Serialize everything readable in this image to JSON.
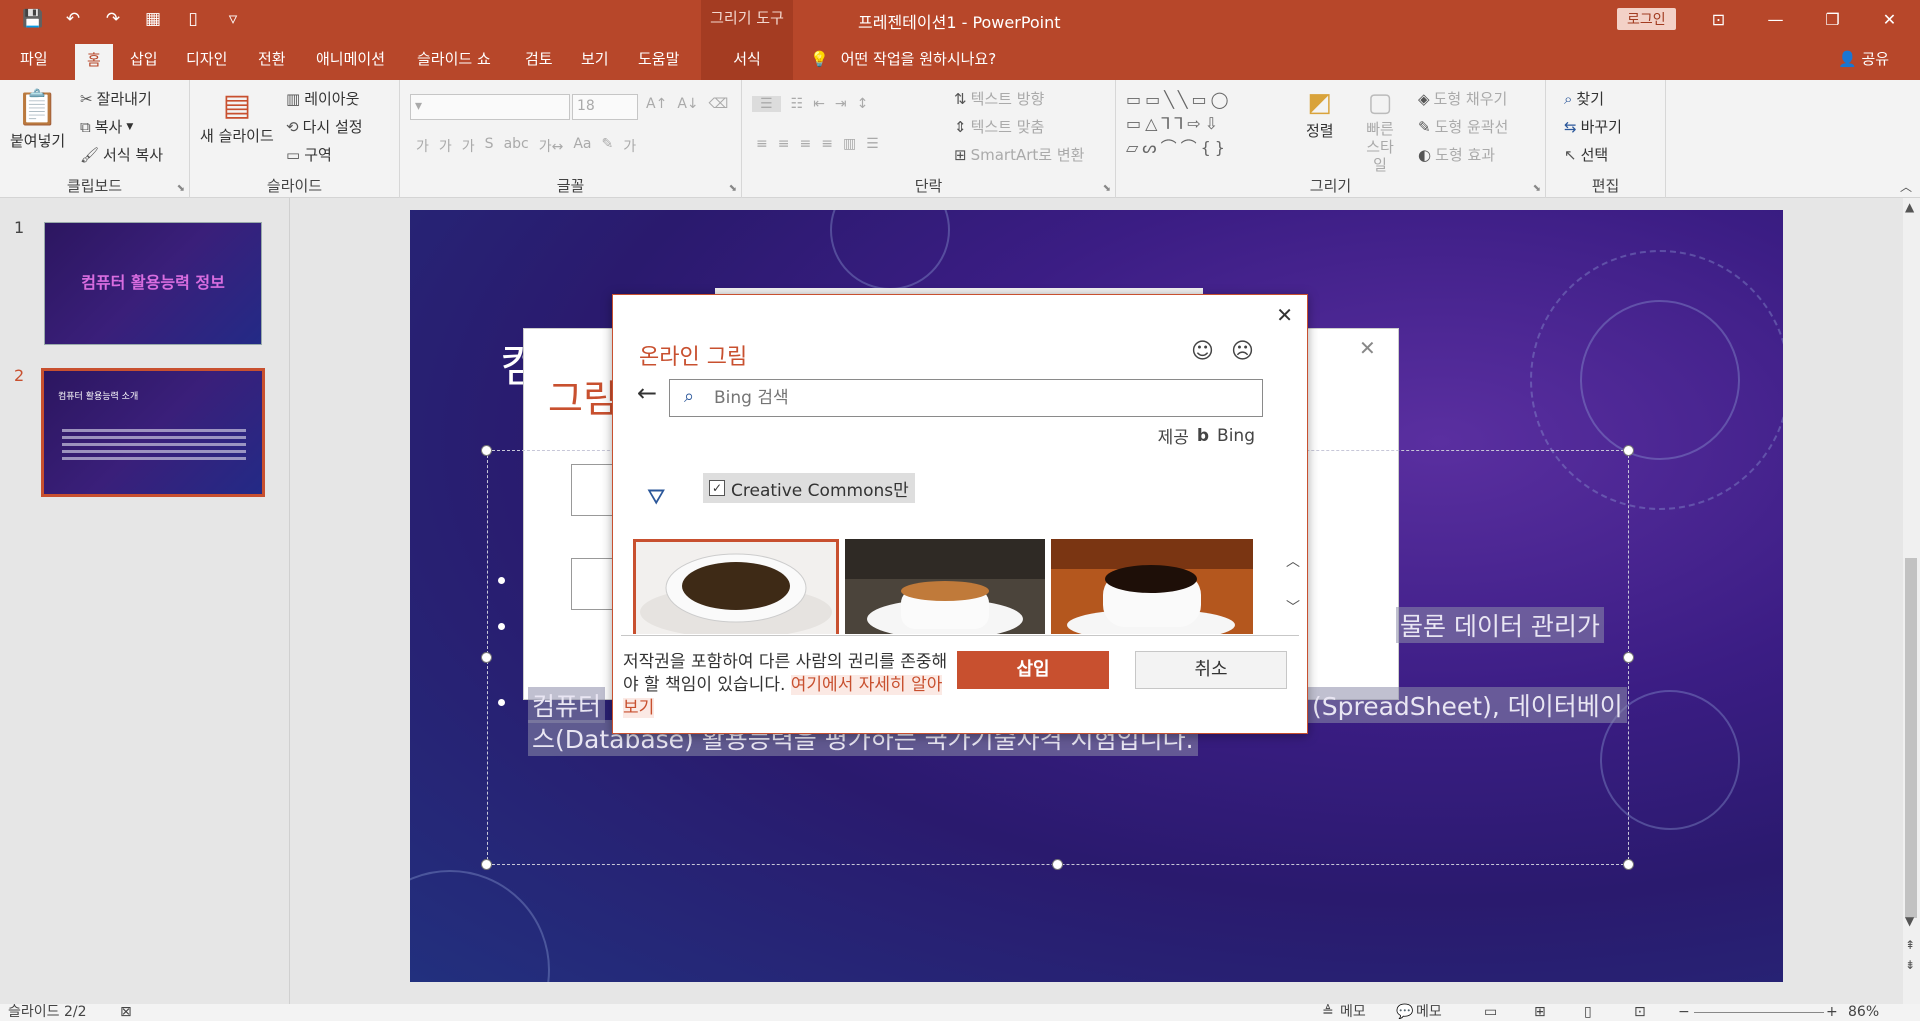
{
  "titlebar": {
    "context_tab": "그리기 도구",
    "title": "프레젠테이션1  -  PowerPoint",
    "login": "로그인",
    "qat_icons": [
      "save-icon",
      "undo-icon",
      "redo-icon",
      "presenter-icon",
      "new-doc-icon",
      "customize-icon"
    ]
  },
  "tabs": [
    "파일",
    "홈",
    "삽입",
    "디자인",
    "전환",
    "애니메이션",
    "슬라이드 쇼",
    "검토",
    "보기",
    "도움말"
  ],
  "context_tab_label": "서식",
  "tellme": "어떤 작업을 원하시나요?",
  "share": "공유",
  "ribbon": {
    "clipboard": {
      "paste": "붙여넣기",
      "cut": "잘라내기",
      "copy": "복사",
      "format_painter": "서식 복사",
      "label": "클립보드"
    },
    "slides": {
      "new_slide": "새 슬라이드",
      "layout": "레이아웃",
      "reset": "다시 설정",
      "section": "구역",
      "label": "슬라이드"
    },
    "font": {
      "size": "18",
      "label": "글꼴"
    },
    "paragraph": {
      "text_direction": "텍스트 방향",
      "align_text": "텍스트 맞춤",
      "smartart": "SmartArt로 변환",
      "label": "단락"
    },
    "drawing": {
      "arrange": "정렬",
      "quick_styles": "빠른 스타일",
      "fill": "도형 채우기",
      "outline": "도형 윤곽선",
      "effects": "도형 효과",
      "label": "그리기"
    },
    "editing": {
      "find": "찾기",
      "replace": "바꾸기",
      "select": "선택",
      "label": "편집"
    }
  },
  "thumbnails": [
    {
      "num": "1",
      "title": "컴퓨터 활용능력 정보"
    },
    {
      "num": "2",
      "title": "컴퓨터 활용능력 소개"
    }
  ],
  "slide": {
    "title_fragment": "컴",
    "text1": "물론 데이터 관리가",
    "text2_left": "컴퓨터",
    "text2_right": "(SpreadSheet), 데이터베이",
    "text3": "스(Database) 활용능력을 평가하는 국가기술자격 시험입니다."
  },
  "bg_dialog": {
    "title": "그림"
  },
  "dialog": {
    "title": "온라인 그림",
    "search_placeholder": "Bing 검색",
    "provider_prefix": "제공",
    "provider_name": "Bing",
    "creative_commons": "Creative Commons만",
    "legal": "저작권을 포함하여 다른 사람의 권리를 존중해야 할 책임이 있습니다.",
    "learn_more": "여기에서 자세히 알아보기",
    "insert": "삽입",
    "cancel": "취소"
  },
  "status": {
    "slide": "슬라이드 2/2",
    "notes": "메모",
    "comments": "메모",
    "zoom": "86%"
  }
}
